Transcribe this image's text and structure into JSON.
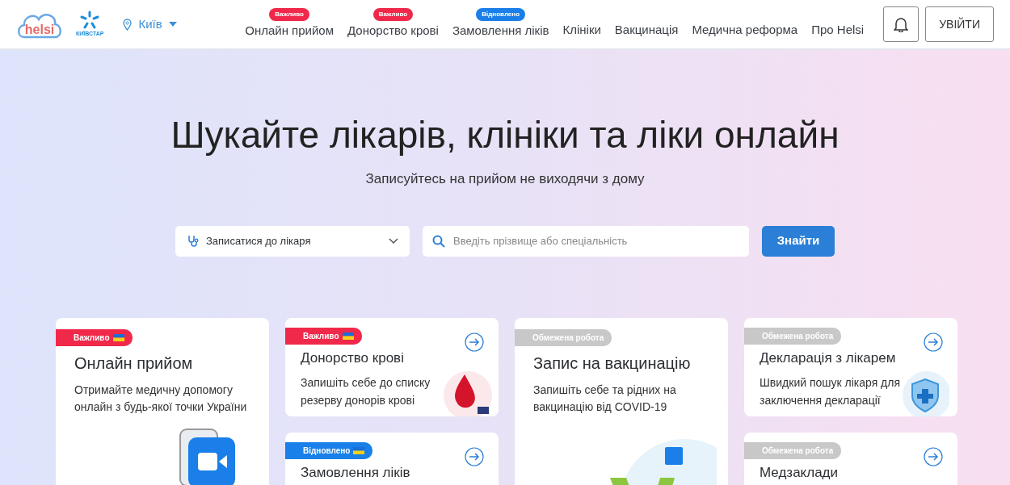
{
  "header": {
    "logo_text": "helsi",
    "partner_text": "КИЇВСТАР",
    "city": "Київ",
    "nav": [
      {
        "label": "Онлайн прийом",
        "badge": {
          "kind": "important",
          "label": "Важливо"
        }
      },
      {
        "label": "Донорство крові",
        "badge": {
          "kind": "important",
          "label": "Важливо"
        }
      },
      {
        "label": "Замовлення ліків",
        "badge": {
          "kind": "renewed",
          "label": "Відновлено"
        }
      },
      {
        "label": "Клініки"
      },
      {
        "label": "Вакцинація"
      },
      {
        "label": "Медична реформа"
      },
      {
        "label": "Про Helsi"
      }
    ],
    "login": "УВІЙТИ"
  },
  "hero": {
    "title": "Шукайте лікарів, клініки та ліки онлайн",
    "subtitle": "Записуйтесь на прийом не виходячи з дому"
  },
  "search": {
    "type_select": "Записатися до лікаря",
    "placeholder": "Введіть прізвище або спеціальність",
    "button": "Знайти"
  },
  "columns": [
    {
      "cards": [
        {
          "kind": "video",
          "badge": {
            "kind": "important",
            "label": "Важливо",
            "flag": true
          },
          "title": "Онлайн прийом",
          "text": "Отримайте медичну допомогу онлайн з будь-якої точки України"
        }
      ]
    },
    {
      "cards": [
        {
          "kind": "blood",
          "badge": {
            "kind": "important",
            "label": "Важливо",
            "flag": true
          },
          "title": "Донорство крові",
          "text": "Запишіть себе до списку резерву донорів крові"
        },
        {
          "kind": "plain",
          "badge": {
            "kind": "renewed",
            "label": "Відновлено",
            "flag": true
          },
          "title": "Замовлення ліків"
        }
      ]
    },
    {
      "cards": [
        {
          "kind": "vaccine",
          "badge": {
            "kind": "limited",
            "label": "Обмежена робота",
            "flag": false
          },
          "title": "Запис на вакцинацію",
          "text": "Запишіть себе та рідних на вакцинацію від COVID-19"
        }
      ]
    },
    {
      "cards": [
        {
          "kind": "shield",
          "badge": {
            "kind": "limited",
            "label": "Обмежена робота",
            "flag": false
          },
          "title": "Декларація з лікарем",
          "text": "Швидкий пошук лікаря для заключення декларації"
        },
        {
          "kind": "plain",
          "badge": {
            "kind": "limited",
            "label": "Обмежена робота",
            "flag": false
          },
          "title": "Медзаклади"
        }
      ]
    }
  ]
}
